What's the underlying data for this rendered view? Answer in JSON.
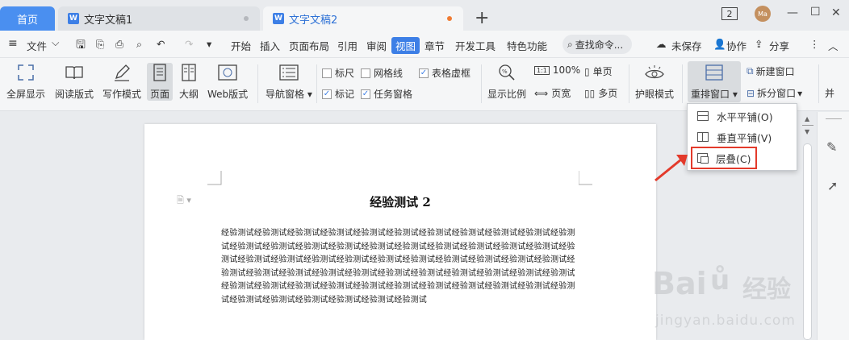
{
  "tabs": {
    "home": "首页",
    "doc1": "文字文稿1",
    "doc2": "文字文稿2",
    "doc_icon": "W"
  },
  "window": {
    "badge": "2",
    "avatar": "Ma"
  },
  "menubar": {
    "file": "文件",
    "items": [
      "开始",
      "插入",
      "页面布局",
      "引用",
      "审阅",
      "视图",
      "章节",
      "开发工具",
      "特色功能"
    ],
    "search": "查找命令...",
    "unsaved": "未保存",
    "collab": "协作",
    "share": "分享"
  },
  "ribbon": {
    "fullscreen": "全屏显示",
    "reading": "阅读版式",
    "writing": "写作模式",
    "page": "页面",
    "outline": "大纲",
    "web": "Web版式",
    "nav_pane": "导航窗格",
    "ruler": "标尺",
    "gridlines": "网格线",
    "table_borders": "表格虚框",
    "marks": "标记",
    "task_pane": "任务窗格",
    "zoom": "显示比例",
    "zoom_100": "100%",
    "page_width": "页宽",
    "single_page": "单页",
    "multi_page": "多页",
    "eye_mode": "护眼模式",
    "arrange": "重排窗口",
    "new_window": "新建窗口",
    "split_window": "拆分窗口",
    "more": "并"
  },
  "dropdown": {
    "items": [
      "水平平铺(O)",
      "垂直平铺(V)",
      "层叠(C)"
    ]
  },
  "document": {
    "title": "经验测试 2",
    "body": "经验测试经验测试经验测试经验测试经验测试经验测试经验测试经验测试经验测试经验测试经验测试经验测试经验测试经验测试经验测试经验测试经验测试经验测试经验测试经验测试经验测试经验测试经验测试经验测试经验测试经验测试经验测试经验测试经验测试经验测试经验测试经验测试经验测试经验测试经验测试经验测试经验测试经验测试经验测试经验测试经验测试经验测试经验测试经验测试经验测试经验测试经验测试经验测试经验测试经验测试经验测试经验测试经验测试经验测试经验测试经验测试经验测试经验测试经验测试经验测试"
  },
  "watermark": {
    "brand": "Bai",
    "brand_cn": "经验",
    "url": "jingyan.baidu.com"
  },
  "colors": {
    "accent": "#3d7fe6",
    "highlight_border": "#e33a2b",
    "tab_active_dot": "#f07b32"
  }
}
